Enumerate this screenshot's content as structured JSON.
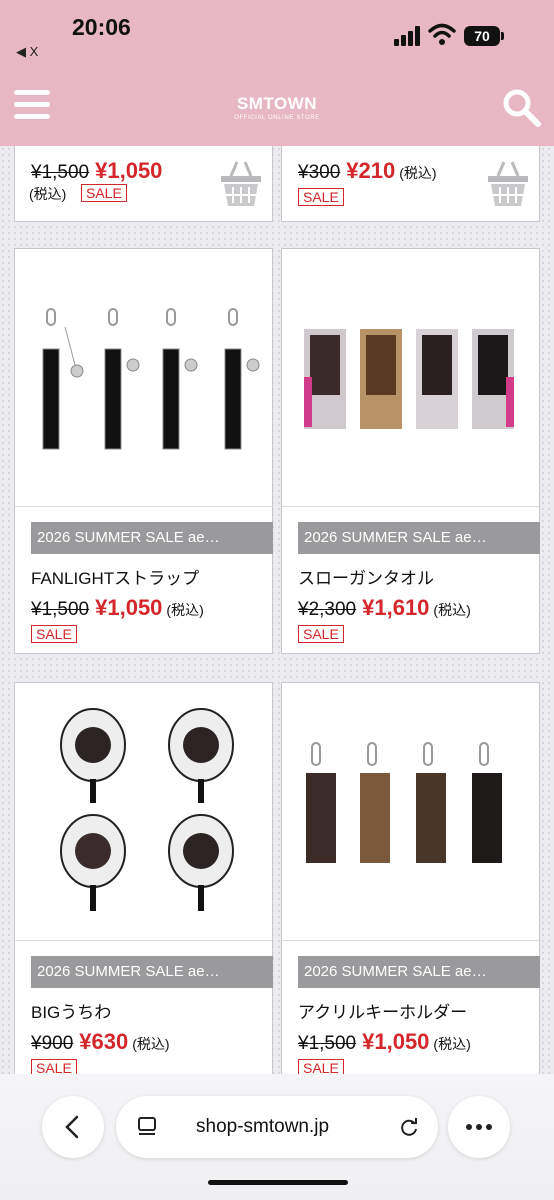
{
  "status": {
    "time": "20:06",
    "back_label": "◀ X",
    "battery": "70"
  },
  "header": {
    "brand": "SMTOWN",
    "subtitle": "OFFICIAL ONLINE STORE"
  },
  "top_cards": [
    {
      "old_price": "¥1,500",
      "new_price": "¥1,050",
      "tax": "(税込)",
      "sale": "SALE"
    },
    {
      "old_price": "¥300",
      "new_price": "¥210",
      "tax": "(税込)",
      "sale": "SALE"
    }
  ],
  "products": [
    {
      "tag": "2026 SUMMER SALE ae…",
      "name": "FANLIGHTストラップ",
      "old_price": "¥1,500",
      "new_price": "¥1,050",
      "tax": "(税込)",
      "sale": "SALE"
    },
    {
      "tag": "2026 SUMMER SALE ae…",
      "name": "スローガンタオル",
      "old_price": "¥2,300",
      "new_price": "¥1,610",
      "tax": "(税込)",
      "sale": "SALE"
    },
    {
      "tag": "2026 SUMMER SALE ae…",
      "name": "BIGうちわ",
      "old_price": "¥900",
      "new_price": "¥630",
      "tax": "(税込)",
      "sale": "SALE"
    },
    {
      "tag": "2026 SUMMER SALE ae…",
      "name": "アクリルキーホルダー",
      "old_price": "¥1,500",
      "new_price": "¥1,050",
      "tax": "(税込)",
      "sale": "SALE"
    }
  ],
  "browser": {
    "url": "shop-smtown.jp"
  },
  "colors": {
    "header_pink": "#e7b7c3",
    "sale_red": "#d4262b",
    "tag_gray": "#9a9a9c"
  }
}
